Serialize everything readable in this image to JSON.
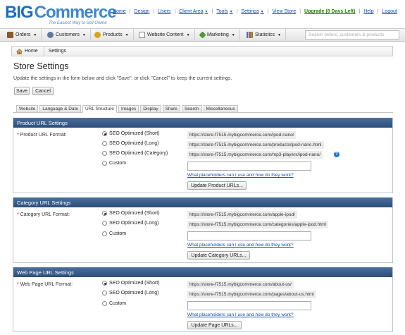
{
  "brand": {
    "logo_text_big": "BIG",
    "logo_text_commerce": "Commerce",
    "tagline": "The Easiest Way to Sell Online"
  },
  "topnav": [
    {
      "label": "Home"
    },
    {
      "label": "Design"
    },
    {
      "label": "Users"
    },
    {
      "label": "Client Area",
      "dropdown": true
    },
    {
      "label": "Tools",
      "dropdown": true
    },
    {
      "label": "Settings",
      "dropdown": true
    },
    {
      "label": "View Store"
    },
    {
      "label": "Upgrade (8 Days Left)"
    },
    {
      "label": "Help"
    },
    {
      "label": "Logout"
    }
  ],
  "mainmenu": [
    {
      "label": "Orders",
      "icon": "orders-icon",
      "color": "#8a5a2a"
    },
    {
      "label": "Customers",
      "icon": "customers-icon",
      "color": "#5a7aa0"
    },
    {
      "label": "Products",
      "icon": "products-icon",
      "color": "#d9a21c"
    },
    {
      "label": "Website Content",
      "icon": "website-content-icon",
      "color": "#8a8a8a"
    },
    {
      "label": "Marketing",
      "icon": "marketing-icon",
      "color": "#4c9a2a"
    },
    {
      "label": "Statistics",
      "icon": "statistics-icon",
      "color": "#3a78b8"
    }
  ],
  "search": {
    "placeholder": "Search orders, customers & products"
  },
  "breadcrumb": {
    "home": "Home",
    "current": "Settings"
  },
  "page": {
    "title": "Store Settings",
    "intro": "Update the settings in the form below and click \"Save\", or click \"Cancel\" to keep the current settings.",
    "save": "Save",
    "cancel": "Cancel"
  },
  "tabs": [
    "Website",
    "Language & Date",
    "URL Structure",
    "Images",
    "Display",
    "Share",
    "Search",
    "Miscellaneous"
  ],
  "active_tab": "URL Structure",
  "sections": [
    {
      "heading": "Product URL Settings",
      "field_label": "Product URL Format:",
      "options": [
        {
          "label": "SEO Optimized (Short)",
          "selected": true,
          "example": "https://store-f7515.mybigcommerce.com/ipod-nano/"
        },
        {
          "label": "SEO Optimized (Long)",
          "selected": false,
          "example": "https://store-f7515.mybigcommerce.com/products/ipod-nano.html"
        },
        {
          "label": "SEO Optimized (Category)",
          "selected": false,
          "example": "https://store-f7515.mybigcommerce.com/mp3-players/ipod-nano/"
        },
        {
          "label": "Custom",
          "selected": false
        }
      ],
      "help_link": "What placeholders can I use and how do they work?",
      "update_button": "Update Product URLs..."
    },
    {
      "heading": "Category URL Settings",
      "field_label": "Category URL Format:",
      "options": [
        {
          "label": "SEO Optimized (Short)",
          "selected": true,
          "example": "https://store-f7515.mybigcommerce.com/apple-ipod/"
        },
        {
          "label": "SEO Optimized (Long)",
          "selected": false,
          "example": "https://store-f7515.mybigcommerce.com/categories/apple-ipod.html"
        },
        {
          "label": "Custom",
          "selected": false
        }
      ],
      "help_link": "What placeholders can I use and how do they work?",
      "update_button": "Update Category URLs..."
    },
    {
      "heading": "Web Page URL Settings",
      "field_label": "Web Page URL Format:",
      "options": [
        {
          "label": "SEO Optimized (Short)",
          "selected": true,
          "example": "https://store-f7515.mybigcommerce.com/about-us/"
        },
        {
          "label": "SEO Optimized (Long)",
          "selected": false,
          "example": "https://store-f7515.mybigcommerce.com/pages/about-us.html"
        },
        {
          "label": "Custom",
          "selected": false
        }
      ],
      "help_link": "What placeholders can I use and how do they work?",
      "update_button": "Update Page URLs..."
    }
  ],
  "colors": {
    "section_header": "#2c4d7a",
    "link": "#1a4fa0",
    "upgrade": "#2a7a12",
    "required": "#cc0000"
  }
}
